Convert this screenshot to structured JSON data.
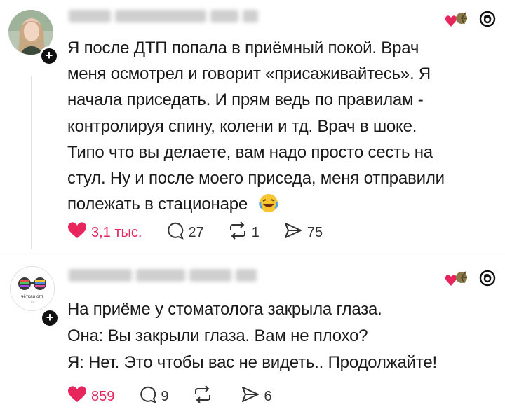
{
  "posts": [
    {
      "text_lines": [
        "Я после ДТП попала в приёмный покой. Врач",
        "меня осмотрел и говорит «присаживайтесь». Я",
        "начала приседать. И прям ведь по правилам -",
        "контролируя спину, колени и тд. Врач в шоке.",
        "Типо что вы делаете, вам надо просто сесть на",
        "стул. Ну и после моего приседа, меня отправили",
        "полежать в стационаре"
      ],
      "likes": "3,1 тыс.",
      "comments": "27",
      "reposts": "1",
      "shares": "75"
    },
    {
      "text_lines": [
        "На приёме у стоматолога закрыла глаза.",
        "Она: Вы закрыли глаза. Вам не плохо?",
        "Я: Нет. Это чтобы вас не видеть.. Продолжайте!"
      ],
      "avatar_text": "чёткая опт",
      "likes": "859",
      "comments": "9",
      "reposts": "",
      "shares": "6"
    }
  ],
  "colors": {
    "like": "#e8265e",
    "text": "#1a1a1a",
    "icon": "#333333"
  }
}
